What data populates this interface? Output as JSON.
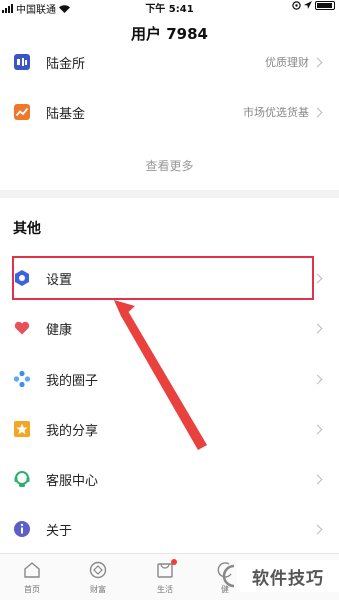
{
  "status_bar": {
    "carrier": "中国联通",
    "time": "下午 5:41"
  },
  "header": {
    "title": "用户 7984"
  },
  "finance": {
    "items": [
      {
        "label": "陆金所",
        "subtitle": "优质理财",
        "icon": "lu-jinsuo-icon",
        "color": "#3a56c4"
      },
      {
        "label": "陆基金",
        "subtitle": "市场优选货基",
        "icon": "lu-jijin-icon",
        "color": "#f0782a"
      }
    ],
    "see_more": "查看更多"
  },
  "other": {
    "title": "其他",
    "items": [
      {
        "label": "设置",
        "icon": "settings-icon",
        "color": "#3c64dc"
      },
      {
        "label": "健康",
        "icon": "heart-icon",
        "color": "#e8505a"
      },
      {
        "label": "我的圈子",
        "icon": "circle-icon",
        "color": "#3c8ef0"
      },
      {
        "label": "我的分享",
        "icon": "star-icon",
        "color": "#f2a623"
      },
      {
        "label": "客服中心",
        "icon": "customer-service-icon",
        "color": "#2fae6c"
      },
      {
        "label": "关于",
        "icon": "info-icon",
        "color": "#5b5fc7"
      }
    ]
  },
  "tabbar": {
    "items": [
      {
        "label": "首页",
        "icon": "home-icon"
      },
      {
        "label": "财富",
        "icon": "wealth-icon"
      },
      {
        "label": "生活",
        "icon": "life-icon"
      },
      {
        "label": "健",
        "icon": "health-tab-icon"
      }
    ]
  },
  "watermark": {
    "text": "软件技巧"
  },
  "colors": {
    "highlight": "#e0334a",
    "divider": "#f2f2f2"
  }
}
